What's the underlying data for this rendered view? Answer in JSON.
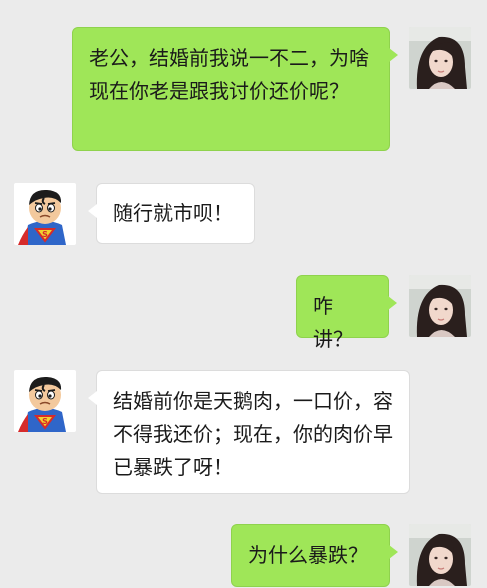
{
  "messages": [
    {
      "side": "right",
      "avatar": "girl-avatar",
      "text": "老公，结婚前我说一不二，为啥现在你老是跟我讨价还价呢？"
    },
    {
      "side": "left",
      "avatar": "superman-avatar",
      "text": "随行就市呗！"
    },
    {
      "side": "right",
      "avatar": "girl-avatar",
      "text": "咋讲？"
    },
    {
      "side": "left",
      "avatar": "superman-avatar",
      "text": "结婚前你是天鹅肉，一口价，容不得我还价；现在，你的肉价早已暴跌了呀！"
    },
    {
      "side": "right",
      "avatar": "girl-avatar",
      "text": "为什么暴跌？"
    }
  ],
  "colors": {
    "background": "#ebebeb",
    "right_bubble": "#9fe658",
    "left_bubble": "#ffffff"
  }
}
